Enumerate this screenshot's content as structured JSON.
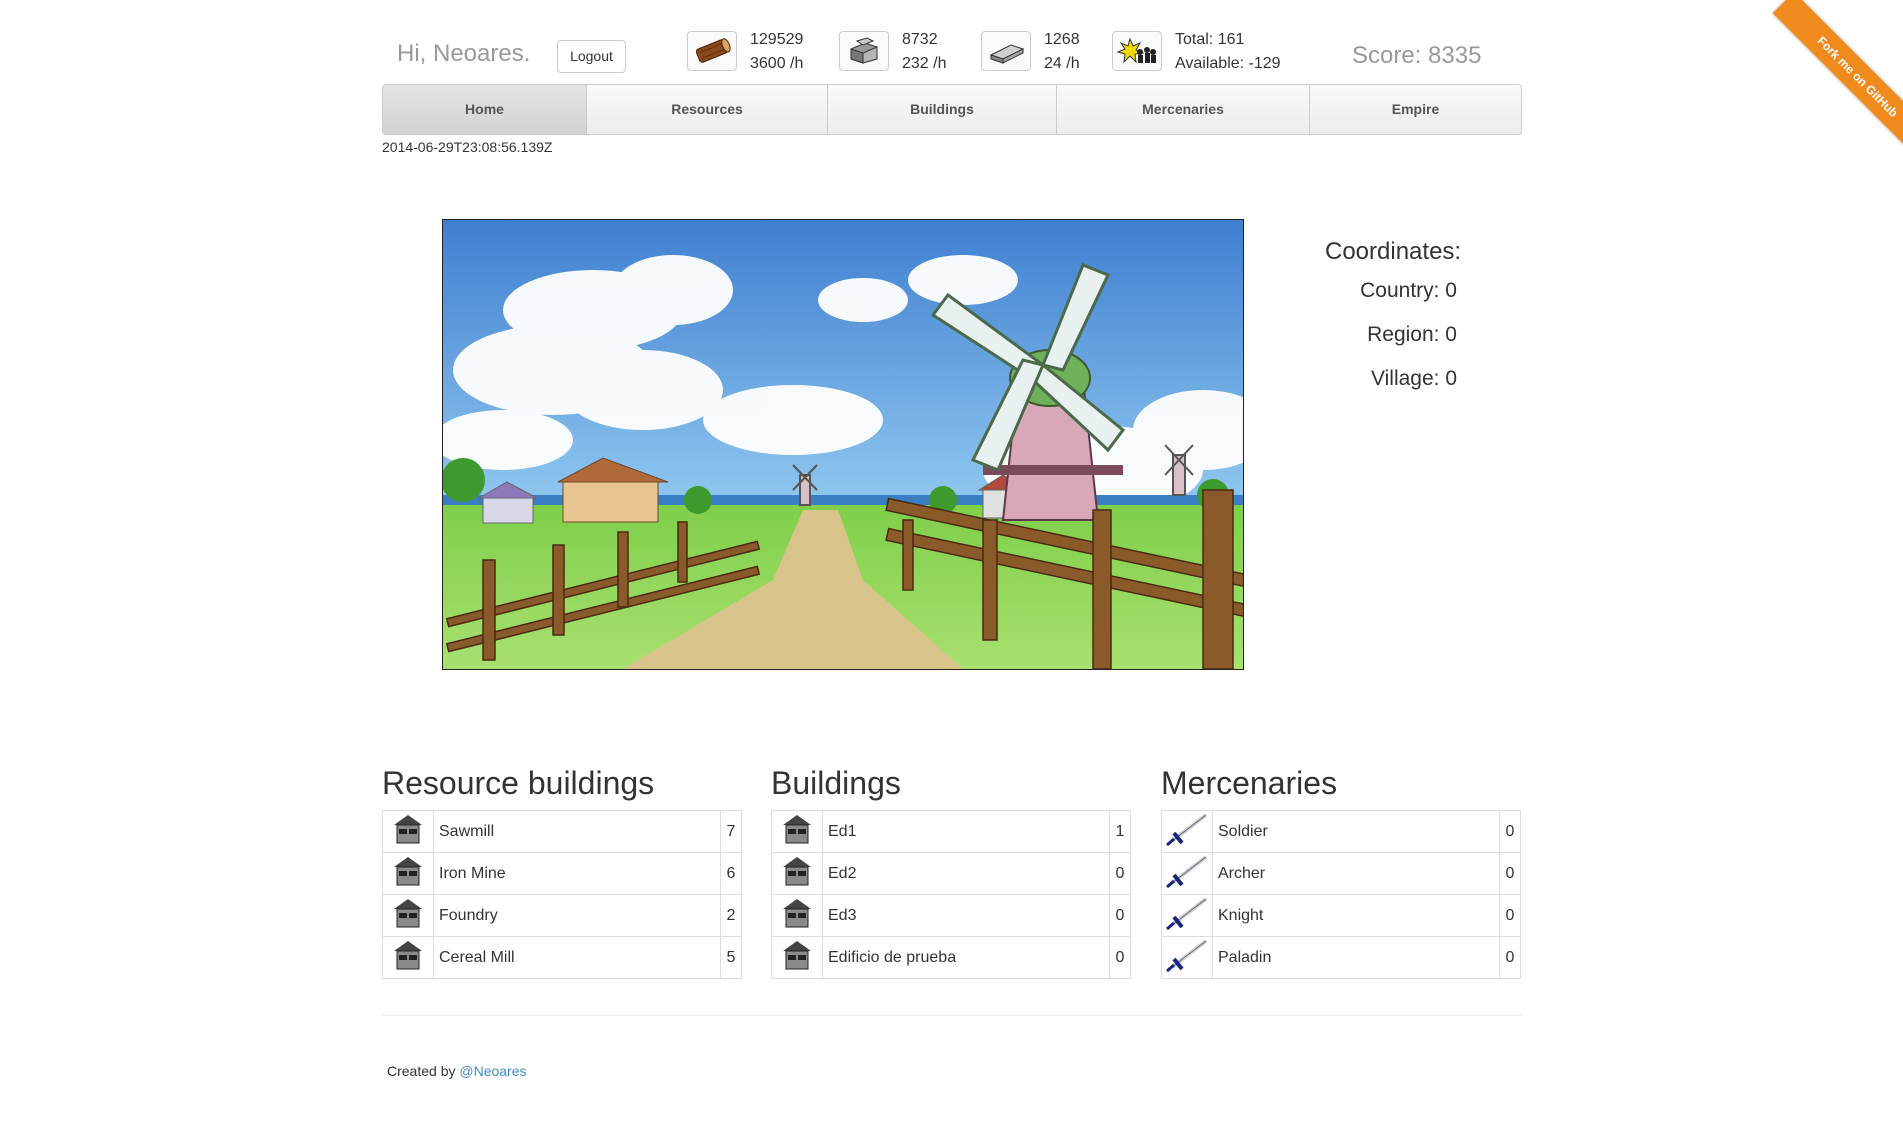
{
  "header": {
    "greeting": "Hi, Neoares.",
    "logout_label": "Logout",
    "wood": {
      "icon": "wood-log-icon",
      "amount": "129529",
      "rate": "3600 /h"
    },
    "stone": {
      "icon": "stone-block-icon",
      "amount": "8732",
      "rate": "232 /h"
    },
    "iron": {
      "icon": "iron-ingot-icon",
      "amount": "1268",
      "rate": "24 /h"
    },
    "population": {
      "icon": "population-icon",
      "total": "Total: 161",
      "available": "Available: -129",
      "available_color": "#ff0000"
    },
    "score": "Score: 8335"
  },
  "nav": {
    "tabs": [
      {
        "label": "Home",
        "active": true
      },
      {
        "label": "Resources",
        "active": false
      },
      {
        "label": "Buildings",
        "active": false
      },
      {
        "label": "Mercenaries",
        "active": false
      },
      {
        "label": "Empire",
        "active": false
      }
    ]
  },
  "timestamp": "2014-06-29T23:08:56.139Z",
  "coordinates": {
    "title": "Coordinates:",
    "country": "Country: 0",
    "region": "Region: 0",
    "village": "Village: 0"
  },
  "resource_buildings": {
    "title": "Resource buildings",
    "icon": "building-icon",
    "rows": [
      {
        "name": "Sawmill",
        "count": "7"
      },
      {
        "name": "Iron Mine",
        "count": "6"
      },
      {
        "name": "Foundry",
        "count": "2"
      },
      {
        "name": "Cereal Mill",
        "count": "5"
      }
    ]
  },
  "buildings": {
    "title": "Buildings",
    "icon": "building-icon",
    "rows": [
      {
        "name": "Ed1",
        "count": "1"
      },
      {
        "name": "Ed2",
        "count": "0"
      },
      {
        "name": "Ed3",
        "count": "0"
      },
      {
        "name": "Edificio de prueba",
        "count": "0"
      }
    ]
  },
  "mercenaries": {
    "title": "Mercenaries",
    "icon": "sword-icon",
    "rows": [
      {
        "name": "Soldier",
        "count": "0"
      },
      {
        "name": "Archer",
        "count": "0"
      },
      {
        "name": "Knight",
        "count": "0"
      },
      {
        "name": "Paladin",
        "count": "0"
      }
    ]
  },
  "footer": {
    "prefix": "Created by ",
    "link": "@Neoares"
  },
  "ribbon": "Fork me on GitHub",
  "colors": {
    "link": "#428bca",
    "ribbon": "#f08a1c"
  }
}
